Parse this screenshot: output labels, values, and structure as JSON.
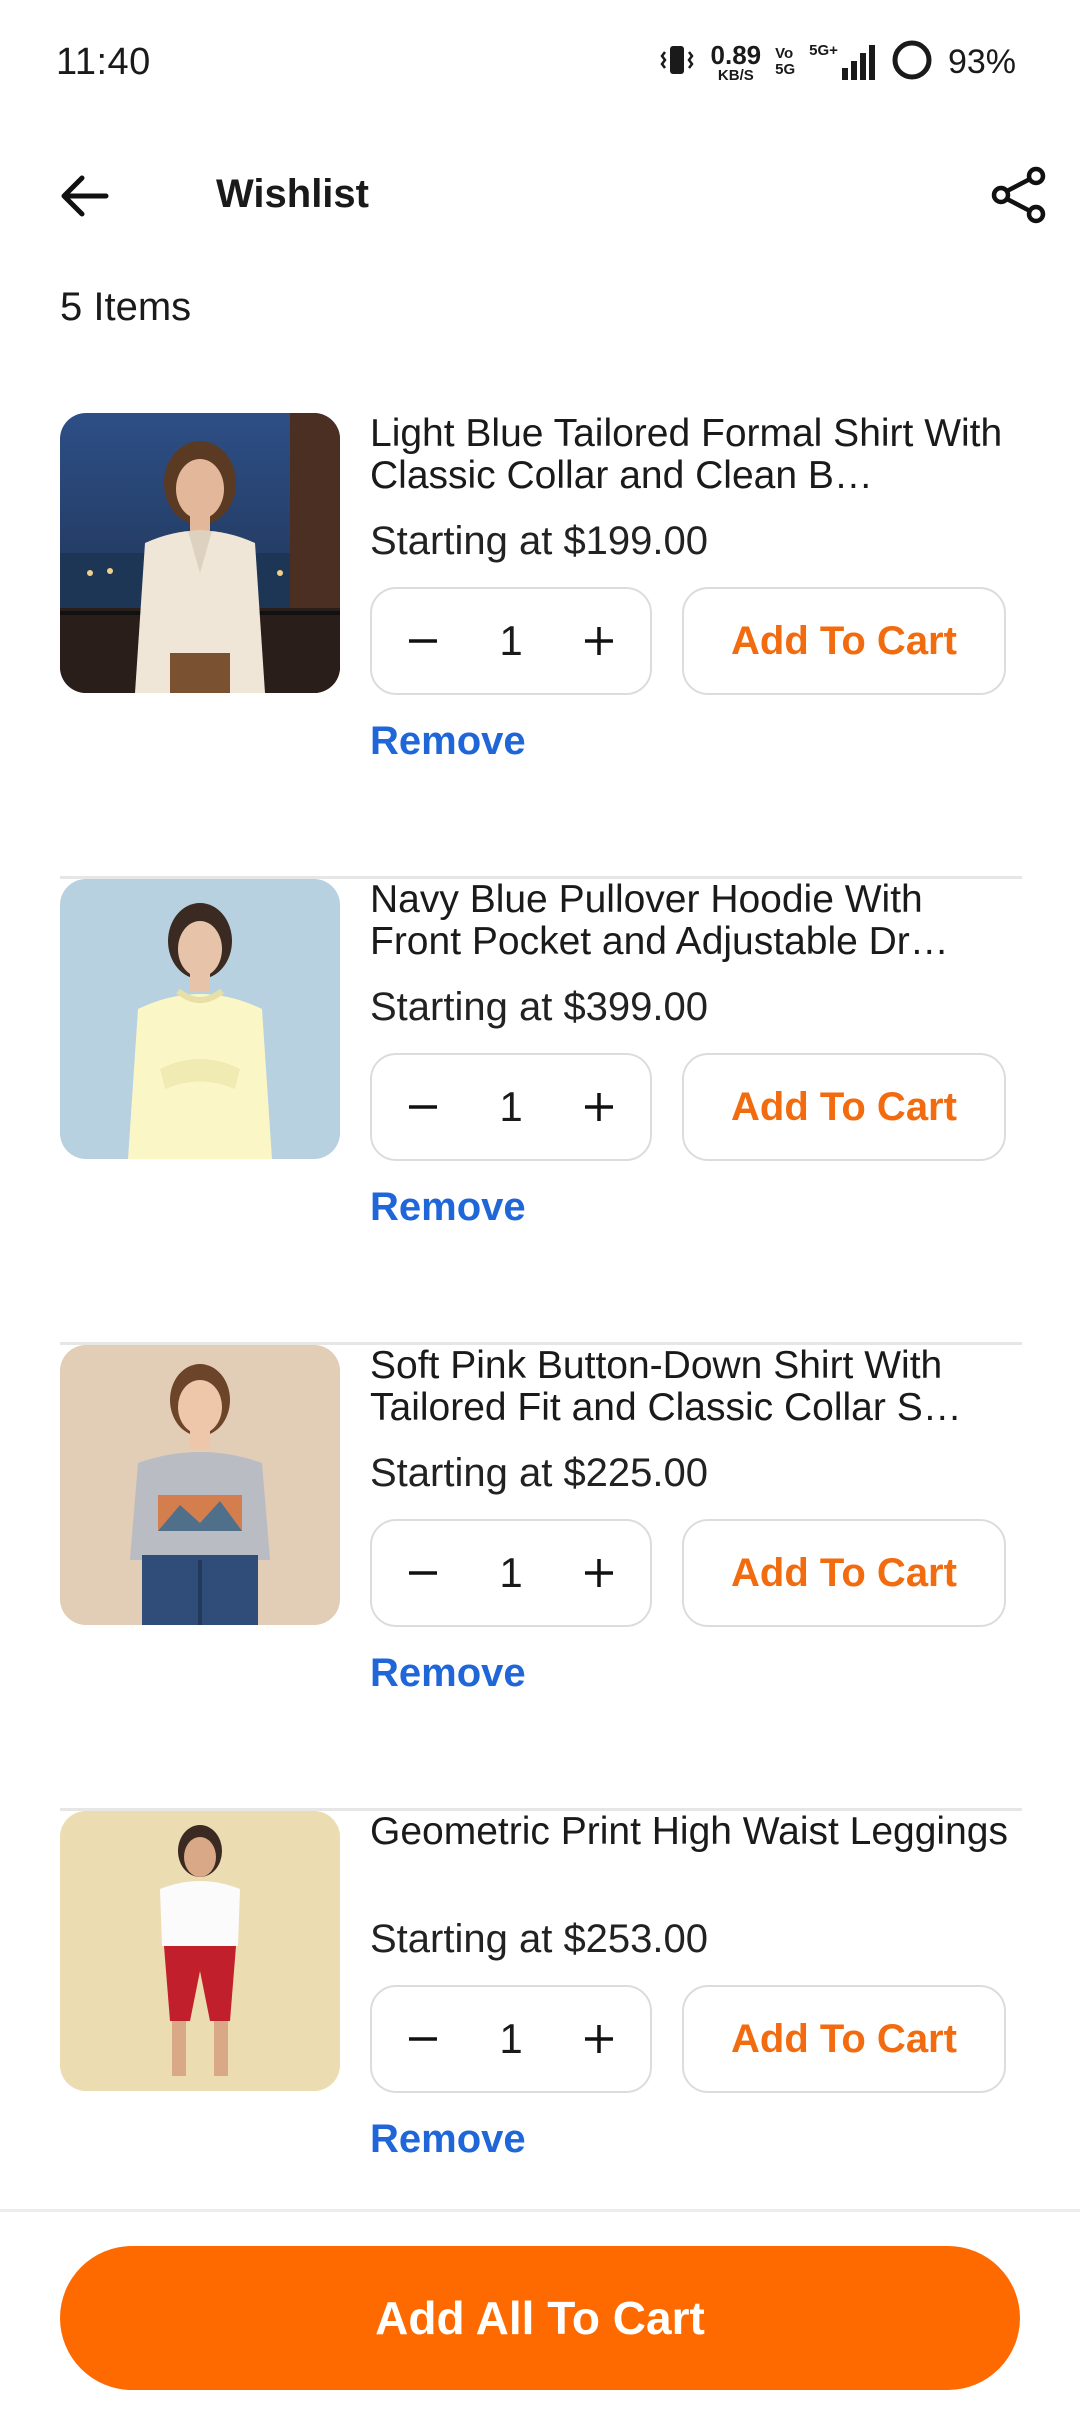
{
  "status_bar": {
    "time": "11:40",
    "net_speed": "0.89",
    "net_unit": "KB/S",
    "vo_top": "Vo",
    "vo_bottom": "5G",
    "network": "5G+",
    "battery": "93%"
  },
  "header": {
    "title": "Wishlist"
  },
  "items_count": "5 Items",
  "items": [
    {
      "name": "Light Blue Tailored Formal Shirt With Classic Collar and Clean B…",
      "price": "Starting at $199.00",
      "quantity": "1",
      "add_label": "Add To Cart",
      "remove_label": "Remove"
    },
    {
      "name": "Navy Blue Pullover Hoodie With Front Pocket and Adjustable Dr…",
      "price": "Starting at $399.00",
      "quantity": "1",
      "add_label": "Add To Cart",
      "remove_label": "Remove"
    },
    {
      "name": "Soft Pink Button-Down Shirt With Tailored Fit and Classic Collar S…",
      "price": "Starting at $225.00",
      "quantity": "1",
      "add_label": "Add To Cart",
      "remove_label": "Remove"
    },
    {
      "name": "Geometric Print High Waist Leggings",
      "price": "Starting at $253.00",
      "quantity": "1",
      "add_label": "Add To Cart",
      "remove_label": "Remove"
    }
  ],
  "add_all_label": "Add All To Cart",
  "colors": {
    "accent_orange": "#ff6a00",
    "add_text_orange": "#f26b0f",
    "remove_blue": "#1f66d9"
  },
  "icons": {
    "back": "arrow-left-icon",
    "share": "share-icon",
    "minus": "minus-icon",
    "plus": "plus-icon"
  }
}
